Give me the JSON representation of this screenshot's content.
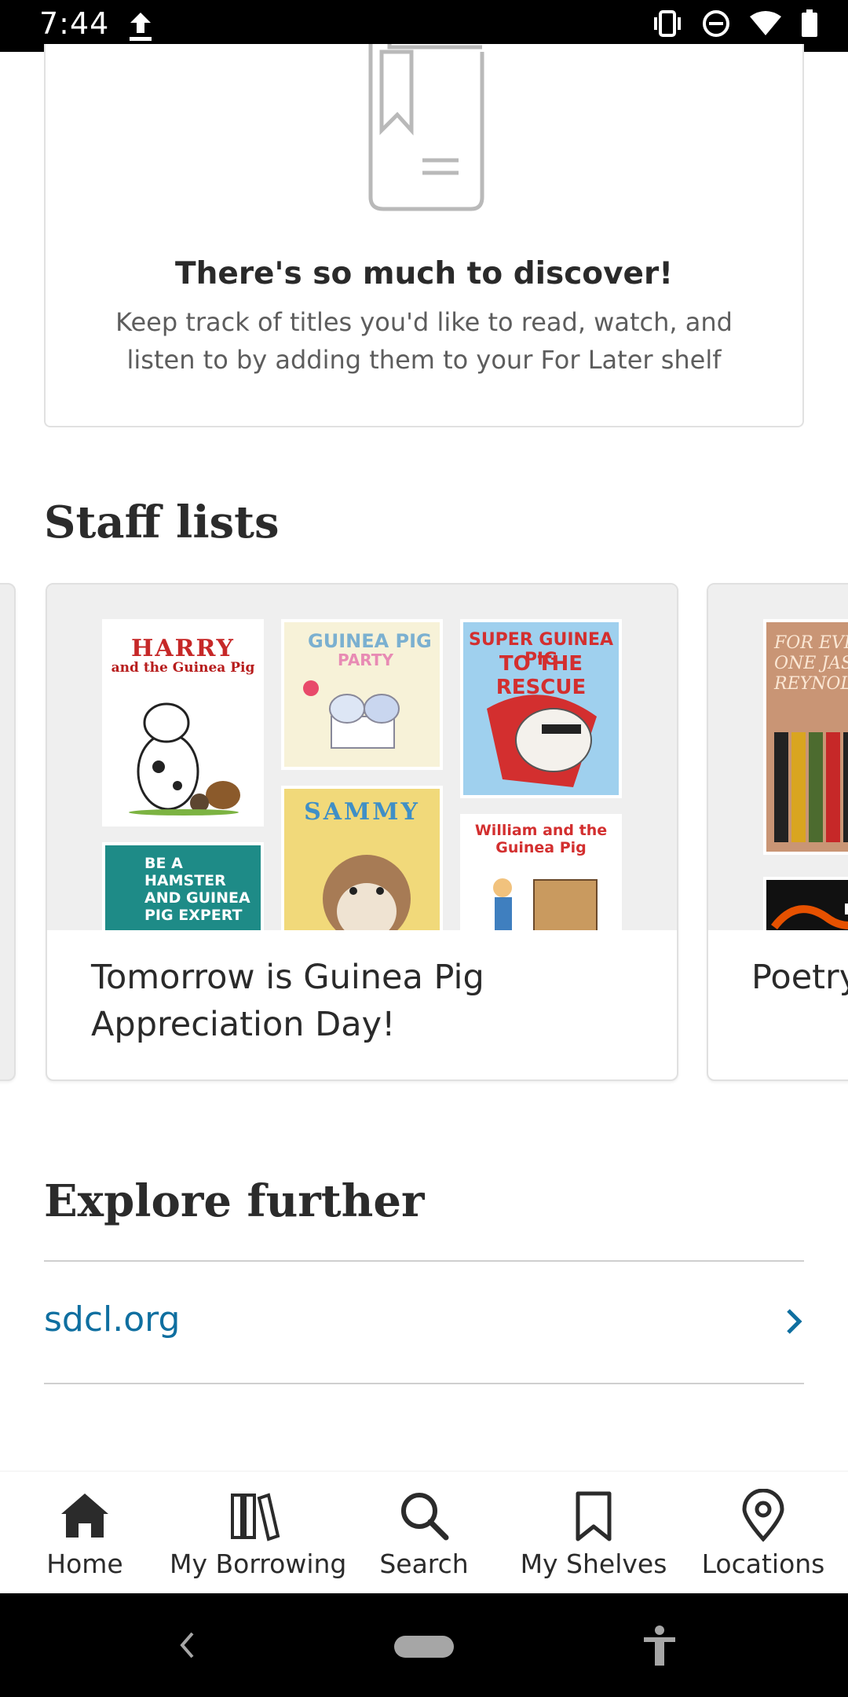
{
  "status_bar": {
    "time": "7:44"
  },
  "discover": {
    "title": "There's so much to discover!",
    "text": "Keep track of titles you'd like to read, watch, and listen to by adding them to your For Later shelf"
  },
  "staff_lists": {
    "heading": "Staff lists",
    "cards": [
      {
        "caption": "Tomorrow is Guinea Pig Appreciation Day!",
        "covers": [
          {
            "line1": "HARRY",
            "line2": "and the Guinea Pig"
          },
          {
            "line1": "GUINEA PIG",
            "line2": "PARTY"
          },
          {
            "line1": "SUPER GUINEA PIG",
            "line2": "TO THE RESCUE"
          },
          {
            "line1": "BE A HAMSTER AND GUINEA PIG EXPERT"
          },
          {
            "line1": "SAMMY"
          },
          {
            "line1": "William and the Guinea Pig"
          }
        ]
      },
      {
        "caption": "Poetry",
        "covers": [
          {
            "line1": "FOR EVERY ONE JASON REYNOLDS"
          }
        ]
      }
    ]
  },
  "explore": {
    "heading": "Explore further",
    "link_label": "sdcl.org"
  },
  "bottom_nav": {
    "items": [
      {
        "label": "Home",
        "icon": "home-icon"
      },
      {
        "label": "My Borrowing",
        "icon": "books-icon"
      },
      {
        "label": "Search",
        "icon": "search-icon"
      },
      {
        "label": "My Shelves",
        "icon": "bookmark-icon"
      },
      {
        "label": "Locations",
        "icon": "location-pin-icon"
      }
    ]
  },
  "colors": {
    "link": "#0f6fa0",
    "text": "#2b2b2b",
    "muted": "#5d5d5d"
  }
}
